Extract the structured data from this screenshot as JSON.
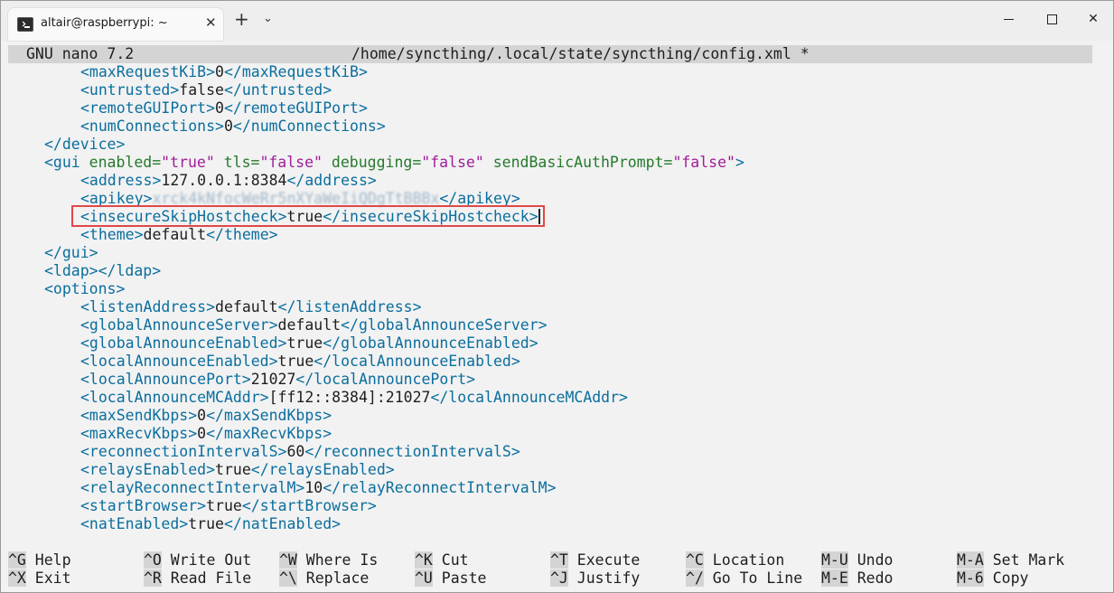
{
  "window": {
    "tab_title": "altair@raspberrypi: ~",
    "tab_close": "✕",
    "new_tab": "+",
    "dropdown": "⌄"
  },
  "nano": {
    "version": "GNU nano 7.2",
    "file": "/home/syncthing/.local/state/syncthing/config.xml *"
  },
  "editor_lines": [
    [
      {
        "c": "tag",
        "t": "<maxRequestKiB>"
      },
      {
        "c": "txt",
        "t": "0"
      },
      {
        "c": "tag",
        "t": "</maxRequestKiB>"
      }
    ],
    [
      {
        "c": "tag",
        "t": "<untrusted>"
      },
      {
        "c": "txt",
        "t": "false"
      },
      {
        "c": "tag",
        "t": "</untrusted>"
      }
    ],
    [
      {
        "c": "tag",
        "t": "<remoteGUIPort>"
      },
      {
        "c": "txt",
        "t": "0"
      },
      {
        "c": "tag",
        "t": "</remoteGUIPort>"
      }
    ],
    [
      {
        "c": "tag",
        "t": "<numConnections>"
      },
      {
        "c": "txt",
        "t": "0"
      },
      {
        "c": "tag",
        "t": "</numConnections>"
      }
    ],
    [
      {
        "c": "tag",
        "t": "</device>"
      }
    ],
    [
      {
        "c": "tag",
        "t": "<gui "
      },
      {
        "c": "attr",
        "t": "enabled="
      },
      {
        "c": "val",
        "t": "\"true\""
      },
      {
        "c": "attr",
        "t": " tls="
      },
      {
        "c": "val",
        "t": "\"false\""
      },
      {
        "c": "attr",
        "t": " debugging="
      },
      {
        "c": "val",
        "t": "\"false\""
      },
      {
        "c": "attr",
        "t": " sendBasicAuthPrompt="
      },
      {
        "c": "val",
        "t": "\"false\""
      },
      {
        "c": "tag",
        "t": ">"
      }
    ],
    [
      {
        "c": "tag",
        "t": "<address>"
      },
      {
        "c": "txt",
        "t": "127.0.0.1:8384"
      },
      {
        "c": "tag",
        "t": "</address>"
      }
    ],
    [
      {
        "c": "tag",
        "t": "<apikey>"
      },
      {
        "c": "blur",
        "t": "xrck4kNfocWeRr5nXYaWeIiQDgTtBBBx"
      },
      {
        "c": "tag",
        "t": "</apikey>"
      }
    ],
    [
      {
        "c": "tag",
        "t": "<insecureSkipHostcheck>"
      },
      {
        "c": "txt",
        "t": "true"
      },
      {
        "c": "tag",
        "t": "</insecureSkipHostcheck>"
      }
    ],
    [
      {
        "c": "tag",
        "t": "<theme>"
      },
      {
        "c": "txt",
        "t": "default"
      },
      {
        "c": "tag",
        "t": "</theme>"
      }
    ],
    [
      {
        "c": "tag",
        "t": "</gui>"
      }
    ],
    [
      {
        "c": "tag",
        "t": "<ldap></ldap>"
      }
    ],
    [
      {
        "c": "tag",
        "t": "<options>"
      }
    ],
    [
      {
        "c": "tag",
        "t": "<listenAddress>"
      },
      {
        "c": "txt",
        "t": "default"
      },
      {
        "c": "tag",
        "t": "</listenAddress>"
      }
    ],
    [
      {
        "c": "tag",
        "t": "<globalAnnounceServer>"
      },
      {
        "c": "txt",
        "t": "default"
      },
      {
        "c": "tag",
        "t": "</globalAnnounceServer>"
      }
    ],
    [
      {
        "c": "tag",
        "t": "<globalAnnounceEnabled>"
      },
      {
        "c": "txt",
        "t": "true"
      },
      {
        "c": "tag",
        "t": "</globalAnnounceEnabled>"
      }
    ],
    [
      {
        "c": "tag",
        "t": "<localAnnounceEnabled>"
      },
      {
        "c": "txt",
        "t": "true"
      },
      {
        "c": "tag",
        "t": "</localAnnounceEnabled>"
      }
    ],
    [
      {
        "c": "tag",
        "t": "<localAnnouncePort>"
      },
      {
        "c": "txt",
        "t": "21027"
      },
      {
        "c": "tag",
        "t": "</localAnnouncePort>"
      }
    ],
    [
      {
        "c": "tag",
        "t": "<localAnnounceMCAddr>"
      },
      {
        "c": "txt",
        "t": "[ff12::8384]:21027"
      },
      {
        "c": "tag",
        "t": "</localAnnounceMCAddr>"
      }
    ],
    [
      {
        "c": "tag",
        "t": "<maxSendKbps>"
      },
      {
        "c": "txt",
        "t": "0"
      },
      {
        "c": "tag",
        "t": "</maxSendKbps>"
      }
    ],
    [
      {
        "c": "tag",
        "t": "<maxRecvKbps>"
      },
      {
        "c": "txt",
        "t": "0"
      },
      {
        "c": "tag",
        "t": "</maxRecvKbps>"
      }
    ],
    [
      {
        "c": "tag",
        "t": "<reconnectionIntervalS>"
      },
      {
        "c": "txt",
        "t": "60"
      },
      {
        "c": "tag",
        "t": "</reconnectionIntervalS>"
      }
    ],
    [
      {
        "c": "tag",
        "t": "<relaysEnabled>"
      },
      {
        "c": "txt",
        "t": "true"
      },
      {
        "c": "tag",
        "t": "</relaysEnabled>"
      }
    ],
    [
      {
        "c": "tag",
        "t": "<relayReconnectIntervalM>"
      },
      {
        "c": "txt",
        "t": "10"
      },
      {
        "c": "tag",
        "t": "</relayReconnectIntervalM>"
      }
    ],
    [
      {
        "c": "tag",
        "t": "<startBrowser>"
      },
      {
        "c": "txt",
        "t": "true"
      },
      {
        "c": "tag",
        "t": "</startBrowser>"
      }
    ],
    [
      {
        "c": "tag",
        "t": "<natEnabled>"
      },
      {
        "c": "txt",
        "t": "true"
      },
      {
        "c": "tag",
        "t": "</natEnabled>"
      }
    ]
  ],
  "shortcuts": [
    {
      "key": "^G",
      "label": "Help"
    },
    {
      "key": "^X",
      "label": "Exit"
    },
    {
      "key": "^O",
      "label": "Write Out"
    },
    {
      "key": "^R",
      "label": "Read File"
    },
    {
      "key": "^W",
      "label": "Where Is"
    },
    {
      "key": "^\\",
      "label": "Replace"
    },
    {
      "key": "^K",
      "label": "Cut"
    },
    {
      "key": "^U",
      "label": "Paste"
    },
    {
      "key": "^T",
      "label": "Execute"
    },
    {
      "key": "^J",
      "label": "Justify"
    },
    {
      "key": "^C",
      "label": "Location"
    },
    {
      "key": "^/",
      "label": "Go To Line"
    },
    {
      "key": "M-U",
      "label": "Undo"
    },
    {
      "key": "M-E",
      "label": "Redo"
    },
    {
      "key": "M-A",
      "label": "Set Mark"
    },
    {
      "key": "M-6",
      "label": "Copy"
    }
  ]
}
